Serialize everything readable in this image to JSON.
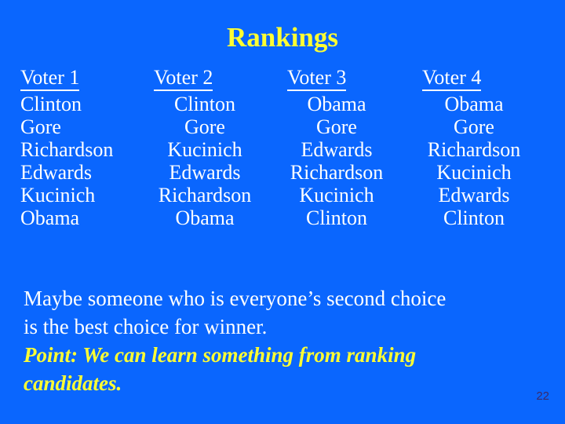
{
  "slide": {
    "title": "Rankings",
    "page_number": "22",
    "background_color": "#0a66fe",
    "accent_color": "#ffff33",
    "text_color": "#ffffff",
    "page_number_color": "#3a2a6a"
  },
  "table": {
    "headers": [
      "Voter 1",
      "Voter 2",
      "Voter 3",
      "Voter 4"
    ],
    "rows": [
      [
        "Clinton",
        "Clinton",
        "Obama",
        "Obama"
      ],
      [
        "Gore",
        "Gore",
        "Gore",
        "Gore"
      ],
      [
        "Richardson",
        "Kucinich",
        "Edwards",
        "Richardson"
      ],
      [
        "Edwards",
        "Edwards",
        "Richardson",
        "Kucinich"
      ],
      [
        "Kucinich",
        "Richardson",
        "Kucinich",
        "Edwards"
      ],
      [
        "Obama",
        "Obama",
        "Clinton",
        "Clinton"
      ]
    ]
  },
  "notes": {
    "line1": "Maybe someone who is everyone’s second choice",
    "line2": "is the best choice for winner.",
    "point1": "Point: We can learn something from ranking",
    "point2": "candidates."
  }
}
